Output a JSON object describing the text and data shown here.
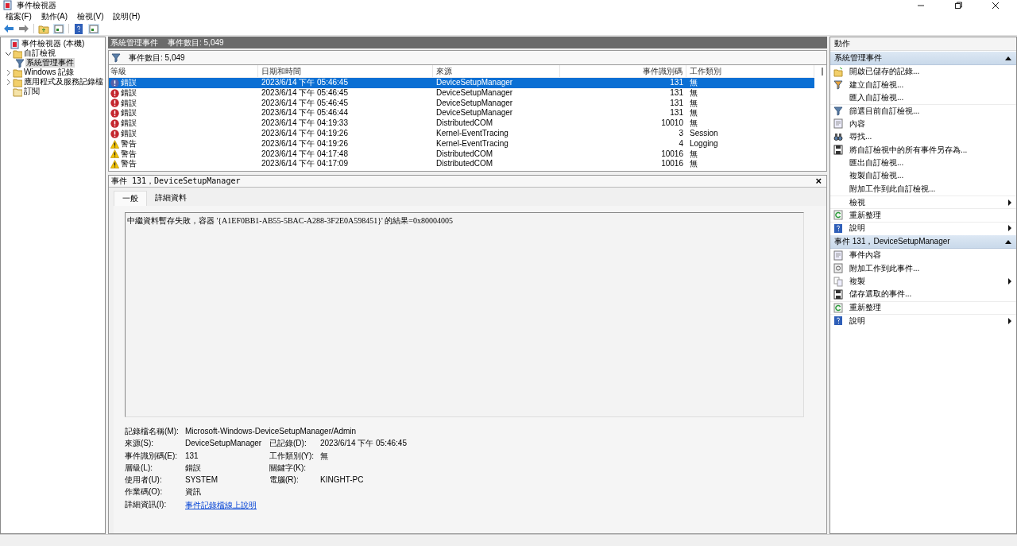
{
  "window": {
    "title": "事件檢視器"
  },
  "menu": [
    {
      "label": "檔案(F)"
    },
    {
      "label": "動作(A)"
    },
    {
      "label": "檢視(V)"
    },
    {
      "label": "說明(H)"
    }
  ],
  "tree": [
    {
      "label": "事件檢視器 (本機)",
      "selected": false,
      "children": [
        {
          "label": "自訂檢視",
          "expanded": true,
          "selected": false,
          "children": [
            {
              "label": "系統管理事件",
              "selected": true
            }
          ]
        },
        {
          "label": "Windows 記錄",
          "expanded": false,
          "selected": false
        },
        {
          "label": "應用程式及服務記錄檔",
          "expanded": false,
          "selected": false
        },
        {
          "label": "訂閱",
          "selected": false
        }
      ]
    }
  ],
  "view": {
    "title": "系統管理事件",
    "count": "事件數目: 5,049",
    "filter_text": "事件數目: 5,049"
  },
  "table": {
    "columns": [
      "等級",
      "日期和時間",
      "來源",
      "事件識別碼",
      "工作類別"
    ],
    "rows": [
      {
        "kind": "error",
        "level": "錯誤",
        "datetime": "2023/6/14 下午 05:46:45",
        "source": "DeviceSetupManager",
        "id": "131",
        "category": "無",
        "selected": true
      },
      {
        "kind": "error",
        "level": "錯誤",
        "datetime": "2023/6/14 下午 05:46:45",
        "source": "DeviceSetupManager",
        "id": "131",
        "category": "無",
        "selected": false
      },
      {
        "kind": "error",
        "level": "錯誤",
        "datetime": "2023/6/14 下午 05:46:45",
        "source": "DeviceSetupManager",
        "id": "131",
        "category": "無",
        "selected": false
      },
      {
        "kind": "error",
        "level": "錯誤",
        "datetime": "2023/6/14 下午 05:46:44",
        "source": "DeviceSetupManager",
        "id": "131",
        "category": "無",
        "selected": false
      },
      {
        "kind": "error",
        "level": "錯誤",
        "datetime": "2023/6/14 下午 04:19:33",
        "source": "DistributedCOM",
        "id": "10010",
        "category": "無",
        "selected": false
      },
      {
        "kind": "error",
        "level": "錯誤",
        "datetime": "2023/6/14 下午 04:19:26",
        "source": "Kernel-EventTracing",
        "id": "3",
        "category": "Session",
        "selected": false
      },
      {
        "kind": "warning",
        "level": "警告",
        "datetime": "2023/6/14 下午 04:19:26",
        "source": "Kernel-EventTracing",
        "id": "4",
        "category": "Logging",
        "selected": false
      },
      {
        "kind": "warning",
        "level": "警告",
        "datetime": "2023/6/14 下午 04:17:48",
        "source": "DistributedCOM",
        "id": "10016",
        "category": "無",
        "selected": false
      },
      {
        "kind": "warning",
        "level": "警告",
        "datetime": "2023/6/14 下午 04:17:09",
        "source": "DistributedCOM",
        "id": "10016",
        "category": "無",
        "selected": false
      }
    ]
  },
  "detail": {
    "title": "事件 131，DeviceSetupManager",
    "close": "×",
    "tabs": [
      {
        "label": "一般",
        "selected": true
      },
      {
        "label": "詳細資料",
        "selected": false
      }
    ],
    "message": "中繼資料暫存失敗，容器 '{A1EF0BB1-AB55-5BAC-A288-3F2E0A598451}' 的結果=0x80004005",
    "properties": [
      [
        {
          "label": "記錄檔名稱(M):",
          "value": "Microsoft-Windows-DeviceSetupManager/Admin"
        }
      ],
      [
        {
          "label": "來源(S):",
          "value": "DeviceSetupManager"
        },
        {
          "label": "已記錄(D):",
          "value": "2023/6/14 下午 05:46:45"
        }
      ],
      [
        {
          "label": "事件識別碼(E):",
          "value": "131"
        },
        {
          "label": "工作類別(Y):",
          "value": "無"
        }
      ],
      [
        {
          "label": "層級(L):",
          "value": "錯誤"
        },
        {
          "label": "關鍵字(K):"
        }
      ],
      [
        {
          "label": "使用者(U):",
          "value": "SYSTEM"
        },
        {
          "label": "電腦(R):",
          "value": "KINGHT-PC"
        }
      ],
      [
        {
          "label": "作業碼(O):",
          "value": "資訊"
        }
      ],
      [
        {
          "label": "詳細資訊(I):",
          "link": "事件記錄檔線上說明"
        }
      ]
    ]
  },
  "actions": {
    "title": "動作",
    "sections": [
      {
        "title": "系統管理事件",
        "expanded": true,
        "items": [
          {
            "label": "開啟已儲存的記錄..."
          },
          {
            "label": "建立自訂檢視..."
          },
          {
            "label": "匯入自訂檢視..."
          },
          {
            "label": "篩選目前自訂檢視...",
            "divider": true
          },
          {
            "label": "內容"
          },
          {
            "label": "尋找..."
          },
          {
            "label": "將自訂檢視中的所有事件另存為..."
          },
          {
            "label": "匯出自訂檢視..."
          },
          {
            "label": "複製自訂檢視..."
          },
          {
            "label": "附加工作到此自訂檢視..."
          },
          {
            "label": "檢視",
            "submenu": true,
            "divider": true
          },
          {
            "label": "重新整理",
            "divider": true
          },
          {
            "label": "說明",
            "submenu": true,
            "divider": true
          }
        ]
      },
      {
        "title": "事件 131，DeviceSetupManager",
        "expanded": true,
        "items": [
          {
            "label": "事件內容"
          },
          {
            "label": "附加工作到此事件..."
          },
          {
            "label": "複製",
            "submenu": true
          },
          {
            "label": "儲存選取的事件..."
          },
          {
            "label": "重新整理",
            "divider": true
          },
          {
            "label": "說明",
            "submenu": true,
            "divider": true
          }
        ]
      }
    ]
  }
}
